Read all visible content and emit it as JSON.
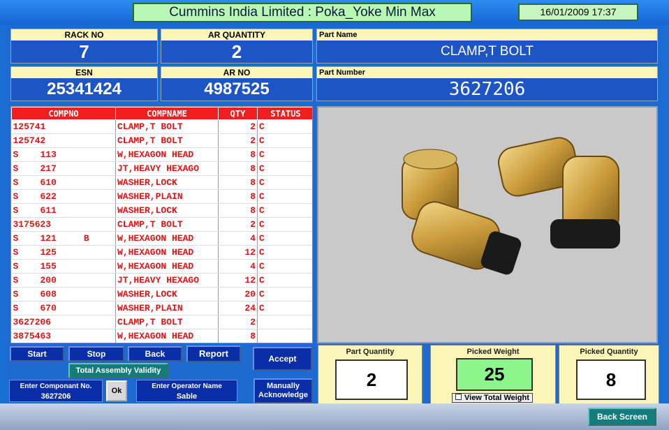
{
  "header": {
    "title": "Cummins India Limited : Poka_Yoke Min Max",
    "datetime": "16/01/2009 17:37"
  },
  "info": {
    "rack_no": {
      "label": "RACK NO",
      "value": "7"
    },
    "ar_quantity": {
      "label": "AR QUANTITY",
      "value": "2"
    },
    "part_name": {
      "label": "Part Name",
      "value": "CLAMP,T BOLT"
    },
    "esn": {
      "label": "ESN",
      "value": "25341424"
    },
    "ar_no": {
      "label": "AR NO",
      "value": "4987525"
    },
    "part_number": {
      "label": "Part Number",
      "value": "3627206"
    }
  },
  "table": {
    "headers": [
      "COMPNO",
      "COMPNAME",
      "QTY",
      "STATUS"
    ],
    "rows": [
      [
        "125741",
        "CLAMP,T BOLT",
        "2",
        "C"
      ],
      [
        "125742",
        "CLAMP,T BOLT",
        "2",
        "C"
      ],
      [
        "S    113",
        "W,HEXAGON HEAD",
        "8",
        "C"
      ],
      [
        "S    217",
        "JT,HEAVY HEXAGO",
        "8",
        "C"
      ],
      [
        "S    610",
        "WASHER,LOCK",
        "8",
        "C"
      ],
      [
        "S    622",
        "WASHER,PLAIN",
        "8",
        "C"
      ],
      [
        "S    611",
        "WASHER,LOCK",
        "8",
        "C"
      ],
      [
        "3175623",
        "CLAMP,T BOLT",
        "2",
        "C"
      ],
      [
        "S    121     B",
        "W,HEXAGON HEAD",
        "4",
        "C"
      ],
      [
        "S    125",
        "W,HEXAGON HEAD",
        "12",
        "C"
      ],
      [
        "S    155",
        "W,HEXAGON HEAD",
        "4",
        "C"
      ],
      [
        "S    200",
        "JT,HEAVY HEXAGO",
        "12",
        "C"
      ],
      [
        "S    608",
        "WASHER,LOCK",
        "20",
        "C"
      ],
      [
        "S    670",
        "WASHER,PLAIN",
        "24",
        "C"
      ],
      [
        "3627206",
        "CLAMP,T BOLT",
        "2",
        ""
      ],
      [
        "3875463",
        "W,HEXAGON HEAD",
        "8",
        ""
      ]
    ]
  },
  "buttons": {
    "start": "Start",
    "stop": "Stop",
    "back": "Back",
    "report": "Report",
    "accept": "Accept",
    "total_assembly": "Total Assembly Validity",
    "ok": "Ok",
    "manual_ack_1": "Manually",
    "manual_ack_2": "Acknowledge",
    "back_screen": "Back Screen"
  },
  "inputs": {
    "component_label": "Enter Componant No.",
    "component_value": "3627206",
    "operator_label": "Enter Operator Name",
    "operator_value": "Sable"
  },
  "panels": {
    "part_quantity": {
      "label": "Part Quantity",
      "value": "2"
    },
    "picked_weight": {
      "label": "Picked Weight",
      "value": "25"
    },
    "picked_quantity": {
      "label": "Picked Quantity",
      "value": "8"
    },
    "view_total_weight": "View Total Weight"
  }
}
